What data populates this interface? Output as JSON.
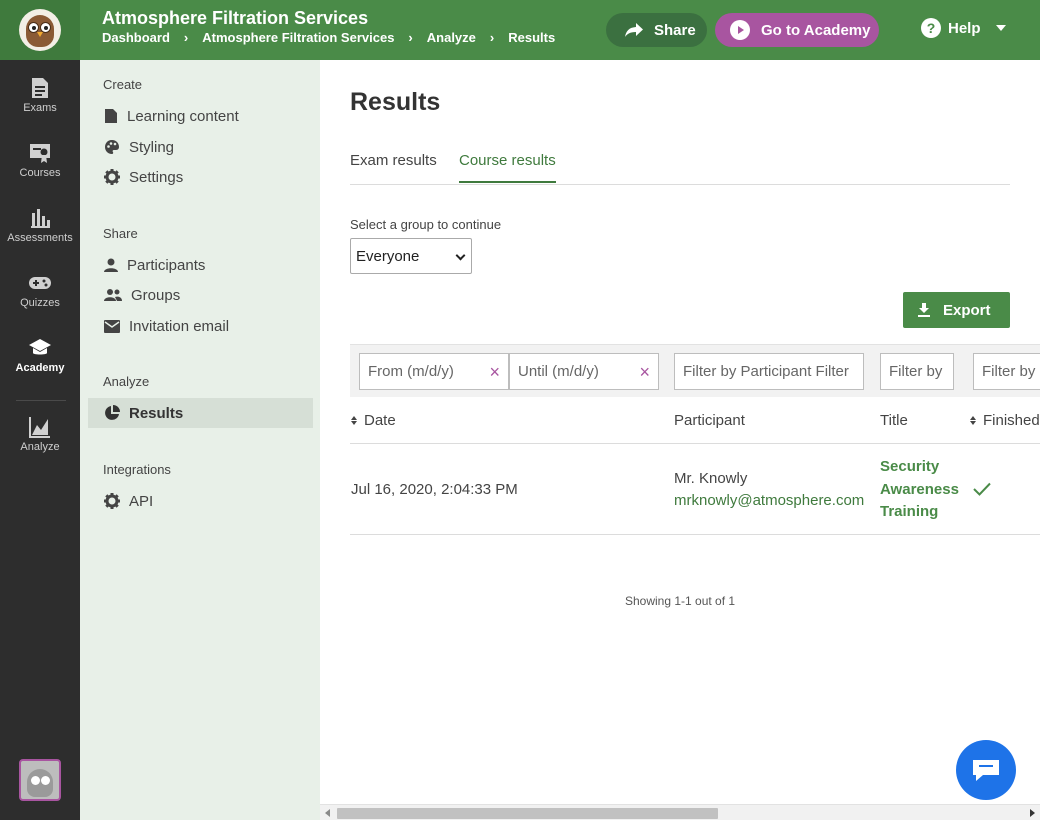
{
  "header": {
    "app_title": "Atmosphere Filtration Services",
    "breadcrumb": [
      "Dashboard",
      "Atmosphere Filtration Services",
      "Analyze",
      "Results"
    ],
    "share_label": "Share",
    "academy_label": "Go to Academy",
    "help_label": "Help",
    "colors": {
      "header_bg": "#4a8b48",
      "share_bg": "#3b7040",
      "academy_bg": "#a855a0"
    }
  },
  "rail": {
    "items": [
      {
        "label": "Exams",
        "icon": "document-icon"
      },
      {
        "label": "Courses",
        "icon": "certificate-icon"
      },
      {
        "label": "Assessments",
        "icon": "bar-chart-icon"
      },
      {
        "label": "Quizzes",
        "icon": "gamepad-icon"
      },
      {
        "label": "Academy",
        "icon": "graduation-cap-icon",
        "active": true
      },
      {
        "label": "Analyze",
        "icon": "area-chart-icon"
      }
    ]
  },
  "sidebar": {
    "sections": [
      {
        "heading": "Create",
        "items": [
          {
            "label": "Learning content",
            "icon": "file-icon"
          },
          {
            "label": "Styling",
            "icon": "palette-icon"
          },
          {
            "label": "Settings",
            "icon": "gear-icon"
          }
        ]
      },
      {
        "heading": "Share",
        "items": [
          {
            "label": "Participants",
            "icon": "person-icon"
          },
          {
            "label": "Groups",
            "icon": "people-icon"
          },
          {
            "label": "Invitation email",
            "icon": "envelope-icon"
          }
        ]
      },
      {
        "heading": "Analyze",
        "items": [
          {
            "label": "Results",
            "icon": "pie-chart-icon",
            "active": true
          }
        ]
      },
      {
        "heading": "Integrations",
        "items": [
          {
            "label": "API",
            "icon": "gear-icon"
          }
        ]
      }
    ]
  },
  "main": {
    "title": "Results",
    "tabs": [
      {
        "label": "Exam results",
        "active": false
      },
      {
        "label": "Course results",
        "active": true
      }
    ],
    "group_label": "Select a group to continue",
    "group_value": "Everyone",
    "export_label": "Export",
    "filters": {
      "from_placeholder": "From (m/d/y)",
      "until_placeholder": "Until (m/d/y)",
      "participant_placeholder": "Filter by Participant Filter",
      "title_placeholder": "Filter by",
      "finished_placeholder": "Filter by"
    },
    "table": {
      "columns": [
        "Date",
        "Participant",
        "Title",
        "Finished"
      ],
      "rows": [
        {
          "date": "Jul 16, 2020, 2:04:33 PM",
          "participant_name": "Mr. Knowly",
          "participant_email": "mrknowly@atmosphere.com",
          "title": "Security Awareness Training",
          "finished": true
        }
      ]
    },
    "showing": "Showing 1-1 out of 1"
  }
}
